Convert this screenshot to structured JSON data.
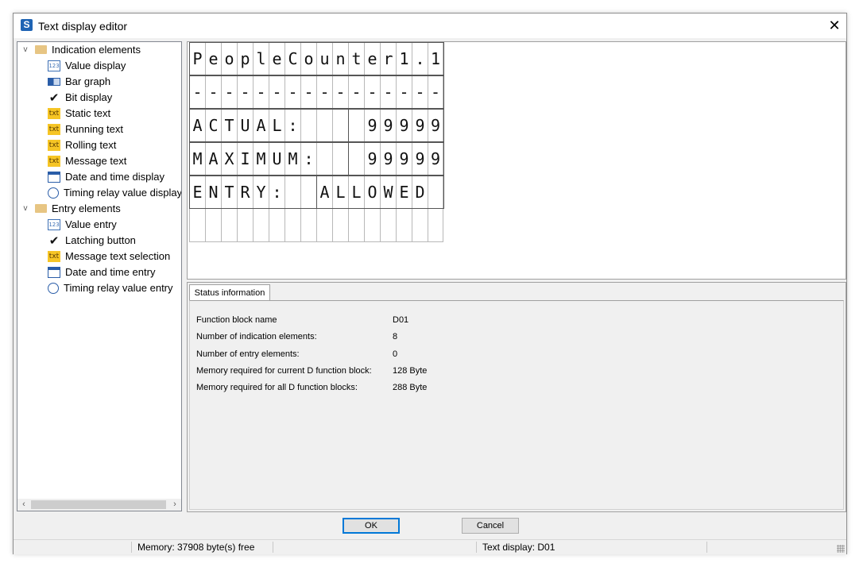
{
  "window": {
    "title": "Text display editor",
    "app_icon_letter": "S",
    "close_glyph": "✕"
  },
  "tree": {
    "groups": [
      {
        "label": "Indication elements",
        "expanded": true,
        "items": [
          {
            "label": "Value display",
            "icon": "value-display-icon",
            "glyph": "123"
          },
          {
            "label": "Bar graph",
            "icon": "bar-graph-icon",
            "glyph": ""
          },
          {
            "label": "Bit display",
            "icon": "checkmark-icon",
            "glyph": "✔"
          },
          {
            "label": "Static text",
            "icon": "static-text-icon",
            "glyph": "txt"
          },
          {
            "label": "Running text",
            "icon": "running-text-icon",
            "glyph": "txt"
          },
          {
            "label": "Rolling text",
            "icon": "rolling-text-icon",
            "glyph": "txt"
          },
          {
            "label": "Message text",
            "icon": "message-text-icon",
            "glyph": "txt"
          },
          {
            "label": "Date and time display",
            "icon": "calendar-icon",
            "glyph": ""
          },
          {
            "label": "Timing relay value display",
            "icon": "timer-icon",
            "glyph": ""
          }
        ]
      },
      {
        "label": "Entry elements",
        "expanded": true,
        "items": [
          {
            "label": "Value entry",
            "icon": "value-entry-icon",
            "glyph": "123"
          },
          {
            "label": "Latching button",
            "icon": "latching-button-icon",
            "glyph": "✔"
          },
          {
            "label": "Message text selection",
            "icon": "message-text-selection-icon",
            "glyph": "txt"
          },
          {
            "label": "Date and time entry",
            "icon": "date-time-entry-icon",
            "glyph": ""
          },
          {
            "label": "Timing relay value entry",
            "icon": "timing-relay-entry-icon",
            "glyph": ""
          }
        ]
      }
    ]
  },
  "lcd": {
    "rows": [
      "PeopleCounter1.1",
      "----------------",
      "ACTUAL:    99999",
      "MAXIMUM:   99999",
      "ENTRY:  ALLOWED ",
      "                "
    ]
  },
  "status": {
    "tab_label": "Status information",
    "rows": [
      {
        "label": "Function block name",
        "value": "D01"
      },
      {
        "label": "Number of indication elements:",
        "value": "8"
      },
      {
        "label": "Number of entry elements:",
        "value": "0"
      },
      {
        "label": "Memory required for current D function block:",
        "value": "128 Byte"
      },
      {
        "label": "Memory required for all D function blocks:",
        "value": "288 Byte"
      }
    ]
  },
  "buttons": {
    "ok": "OK",
    "cancel": "Cancel"
  },
  "statusbar": {
    "memory": "Memory: 37908 byte(s) free",
    "display": "Text display: D01"
  },
  "colors": {
    "accent": "#0078d7",
    "app_icon": "#1f64b4",
    "folder": "#e7c583",
    "txt_icon": "#f6c525"
  }
}
